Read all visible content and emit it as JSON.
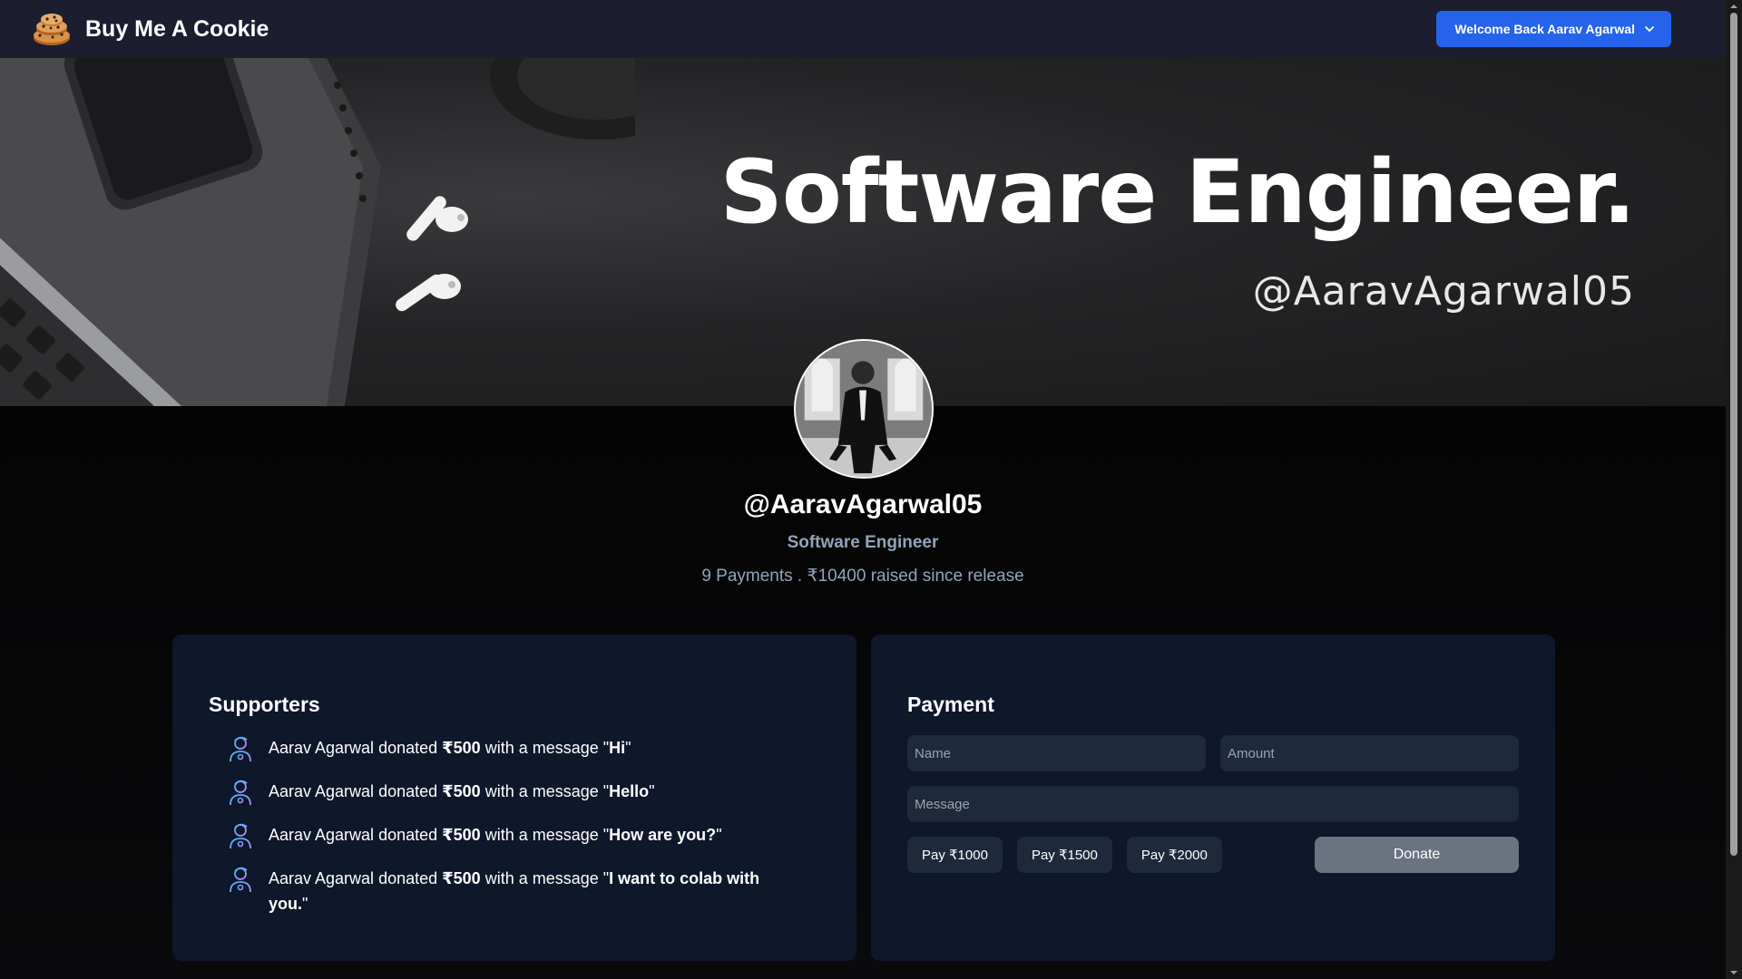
{
  "navbar": {
    "brand_name": "Buy Me A Cookie",
    "brand_icon": "cookie-icon",
    "welcome_label": "Welcome Back Aarav Agarwal"
  },
  "cover": {
    "title": "Software Engineer.",
    "handle": "@AaravAgarwal05"
  },
  "profile": {
    "handle": "@AaravAgarwal05",
    "role": "Software Engineer",
    "stats": "9 Payments . ₹10400 raised since release"
  },
  "supporters": {
    "title": "Supporters",
    "icon": "supporter-avatar-icon",
    "items": [
      {
        "name": "Aarav Agarwal",
        "mid": " donated ",
        "amount": "₹500",
        "pre": " with a message \"",
        "message": "Hi",
        "post": "\""
      },
      {
        "name": "Aarav Agarwal",
        "mid": " donated ",
        "amount": "₹500",
        "pre": " with a message \"",
        "message": "Hello",
        "post": "\""
      },
      {
        "name": "Aarav Agarwal",
        "mid": " donated ",
        "amount": "₹500",
        "pre": " with a message \"",
        "message": "How are you?",
        "post": "\""
      },
      {
        "name": "Aarav Agarwal",
        "mid": " donated ",
        "amount": "₹500",
        "pre": " with a message \"",
        "message": "I want to colab with you.",
        "post": "\""
      }
    ]
  },
  "payment": {
    "title": "Payment",
    "name_placeholder": "Name",
    "amount_placeholder": "Amount",
    "message_placeholder": "Message",
    "quick_amounts": [
      "Pay ₹1000",
      "Pay ₹1500",
      "Pay ₹2000"
    ],
    "donate_label": "Donate"
  },
  "colors": {
    "navbar_bg": "#1c1d2e",
    "accent": "#2563eb",
    "card_bg": "#0f172a",
    "input_bg": "#1e293b",
    "muted_text": "#94a3b8",
    "donate_disabled": "#6b7280"
  }
}
